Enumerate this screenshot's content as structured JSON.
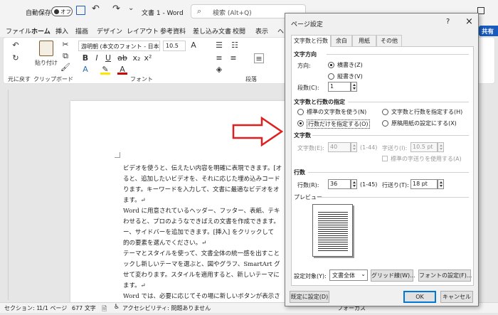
{
  "titlebar": {
    "autosave_label": "自動保存",
    "autosave_state": "オフ",
    "doc_title": "文書 1 - Word",
    "search_placeholder": "検索 (Alt+Q)",
    "colors": {
      "accent": "#185abd",
      "bg": "#f3f3f3"
    }
  },
  "ribbon_tabs": [
    "ファイル",
    "ホーム",
    "挿入",
    "描画",
    "デザイン",
    "レイアウト",
    "参考資料",
    "差し込み文書",
    "校閲",
    "表示",
    "ヘ",
    "共有"
  ],
  "ribbon": {
    "undo_group_label": "元に戻す",
    "clipboard_label": "クリップボード",
    "paste_label": "貼り付け",
    "font_group_label": "フォント",
    "paragraph_group_label": "段落",
    "font_name": "游明朝 (本文のフォント - 日本語)",
    "font_size": "10.5"
  },
  "document": {
    "paragraphs": [
      "ビデオを使うと、伝えたい内容を明確に表現できます。[オ",
      "ると、追加したいビデオを、それに応じた埋め込みコード",
      "ります。キーワードを入力して、文書に最適なビデオをオ",
      "ます。↵",
      "Word に用意されているヘッダー、フッター、表紙、テキ",
      "わせると、プロのようなできばえの文書を作成できます。",
      "ー、サイドバーを追加できます。[挿入] をクリックして",
      "的の要素を選んでください。↵",
      "テーマとスタイルを使って、文書全体の統一感を出すこと",
      "ックし新しいテーマを選ぶと、図やグラフ、SmartArt グ",
      "せて変わります。スタイルを適用すると、新しいテーマに",
      "ます。↵",
      "Word では、必要に応じてその場に新しいボタンが表示さ"
    ]
  },
  "statusbar": {
    "section": "セクション: 1",
    "page": "1/1 ページ",
    "words": "677 文字",
    "accessibility": "アクセシビリティ: 問題ありません",
    "focus": "フォーカス"
  },
  "dialog": {
    "title": "ページ設定",
    "help": "?",
    "close": "×",
    "tabs": [
      "文字数と行数",
      "余白",
      "用紙",
      "その他"
    ],
    "direction_group": "文字方向",
    "direction_label": "方向:",
    "direction_options": [
      "横書き(Z)",
      "縦書き(V)"
    ],
    "columns_label": "段数(C):",
    "columns_value": "1",
    "grid_group": "文字数と行数の指定",
    "grid_options": [
      "標準の文字数を使う(N)",
      "文字数と行数を指定する(H)",
      "行数だけを指定する(O)",
      "原稿用紙の設定にする(X)"
    ],
    "chars_group": "文字数",
    "chars_label": "文字数(E):",
    "chars_value": "40",
    "chars_range": "(1-44)",
    "char_pitch_label": "字送り(I):",
    "char_pitch_value": "10.5 pt",
    "use_standard_pitch": "標準の字送りを使用する(A)",
    "lines_group": "行数",
    "lines_label": "行数(R):",
    "lines_value": "36",
    "lines_range": "(1-45)",
    "line_pitch_label": "行送り(T):",
    "line_pitch_value": "18 pt",
    "preview_group": "プレビュー",
    "apply_label": "設定対象(Y):",
    "apply_value": "文書全体",
    "grid_button": "グリッド線(W)...",
    "font_button": "フォントの設定(F)...",
    "default_button": "既定に設定(D)",
    "ok_button": "OK",
    "cancel_button": "キャンセル"
  }
}
